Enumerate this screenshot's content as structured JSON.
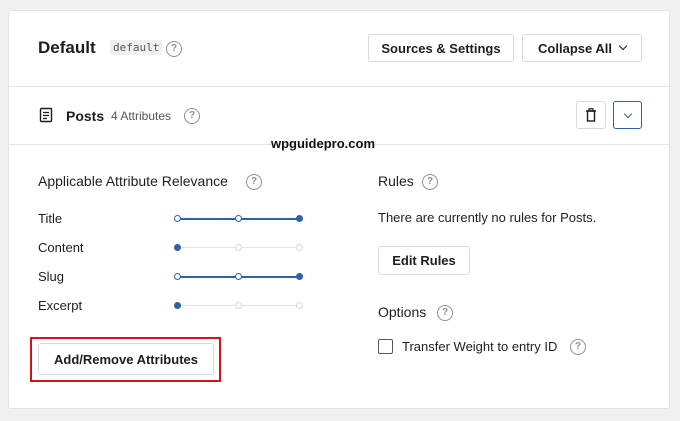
{
  "engine": {
    "title": "Default",
    "slug": "default",
    "help": "?",
    "sources_settings_label": "Sources & Settings",
    "collapse_all_label": "Collapse All"
  },
  "source": {
    "name": "Posts",
    "attributes_count": "4 Attributes",
    "icon": "document-icon",
    "delete_icon": "trash-icon",
    "expand_icon": "chevron-down-icon"
  },
  "watermark": "wpguidepro.com",
  "relevance": {
    "heading": "Applicable Attribute Relevance",
    "attributes": [
      {
        "label": "Title",
        "level": 3
      },
      {
        "label": "Content",
        "level": 1
      },
      {
        "label": "Slug",
        "level": 3
      },
      {
        "label": "Excerpt",
        "level": 1
      }
    ],
    "max_level": 3,
    "add_remove_label": "Add/Remove Attributes"
  },
  "rules": {
    "heading": "Rules",
    "empty_text": "There are currently no rules for Posts.",
    "edit_label": "Edit Rules"
  },
  "options": {
    "heading": "Options",
    "transfer_weight_label": "Transfer Weight to entry ID",
    "transfer_weight_checked": false
  },
  "colors": {
    "accent": "#2c62a8",
    "highlight": "#d0161b"
  }
}
